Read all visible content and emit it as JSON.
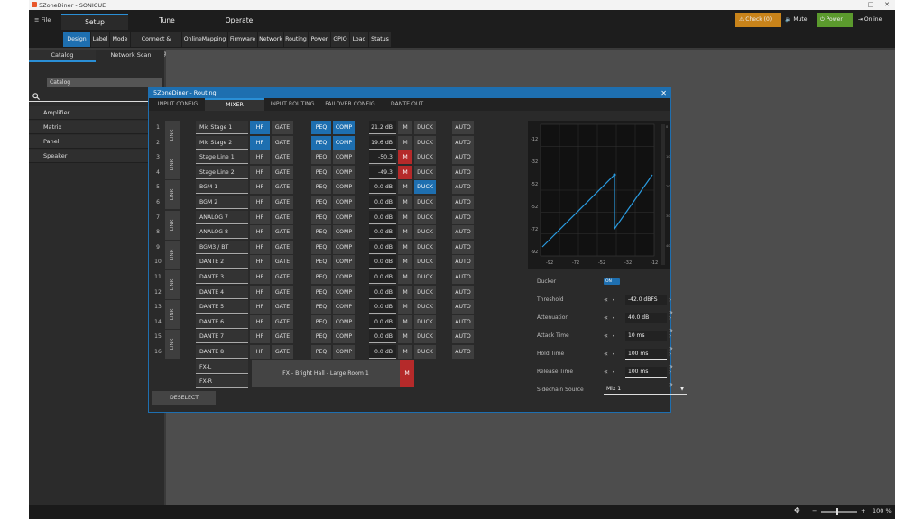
{
  "window": {
    "title": "5ZoneDiner - SONICUE",
    "minimize": "—",
    "maximize": "□",
    "close": "✕"
  },
  "topnav": {
    "file": "≡ File",
    "tabs": [
      "Setup",
      "Tune",
      "Operate"
    ],
    "check": "⚠ Check (0)",
    "mute": "🔈 Mute",
    "power": "⏻ Power",
    "online": "⇥ Online"
  },
  "subnav": [
    "Design",
    "Label",
    "Mode",
    "Connect & Setting",
    "OnlineMapping",
    "Firmware",
    "Network",
    "Routing",
    "Power",
    "GPIO",
    "Load",
    "Status"
  ],
  "left": {
    "tabs": [
      "Catalog",
      "Network Scan"
    ],
    "catalog_label": "Catalog",
    "tree": [
      "Amplifier",
      "Matrix",
      "Panel",
      "Speaker"
    ]
  },
  "status": {
    "zoom": "100 %",
    "minus": "−",
    "plus": "+"
  },
  "dialog": {
    "title": "5ZoneDiner - Routing",
    "close": "✕",
    "tabs": [
      "INPUT CONFIG",
      "MIXER",
      "INPUT ROUTING",
      "FAILOVER CONFIG",
      "DANTE OUT"
    ],
    "link_label": "LINK",
    "hp": "HP",
    "gate": "GATE",
    "peq": "PEQ",
    "comp": "COMP",
    "m": "M",
    "duck": "DUCK",
    "auto": "AUTO",
    "channels": [
      {
        "n": "1",
        "name": "Mic Stage 1",
        "level": "21.2 dB",
        "hp": true,
        "peq": true,
        "comp": true,
        "mute": false,
        "duck": false
      },
      {
        "n": "2",
        "name": "Mic Stage 2",
        "level": "19.6 dB",
        "hp": true,
        "peq": true,
        "comp": true,
        "mute": false,
        "duck": false
      },
      {
        "n": "3",
        "name": "Stage Line 1",
        "level": "-50.3 dB",
        "hp": false,
        "peq": false,
        "comp": false,
        "mute": true,
        "duck": false
      },
      {
        "n": "4",
        "name": "Stage Line 2",
        "level": "-49.3 dB",
        "hp": false,
        "peq": false,
        "comp": false,
        "mute": true,
        "duck": false
      },
      {
        "n": "5",
        "name": "BGM 1",
        "level": "0.0 dB",
        "hp": false,
        "peq": false,
        "comp": false,
        "mute": false,
        "duck": true
      },
      {
        "n": "6",
        "name": "BGM 2",
        "level": "0.0 dB",
        "hp": false,
        "peq": false,
        "comp": false,
        "mute": false,
        "duck": false
      },
      {
        "n": "7",
        "name": "ANALOG 7",
        "level": "0.0 dB",
        "hp": false,
        "peq": false,
        "comp": false,
        "mute": false,
        "duck": false
      },
      {
        "n": "8",
        "name": "ANALOG 8",
        "level": "0.0 dB",
        "hp": false,
        "peq": false,
        "comp": false,
        "mute": false,
        "duck": false
      },
      {
        "n": "9",
        "name": "BGM3 / BT",
        "level": "0.0 dB",
        "hp": false,
        "peq": false,
        "comp": false,
        "mute": false,
        "duck": false
      },
      {
        "n": "10",
        "name": "DANTE 2",
        "level": "0.0 dB",
        "hp": false,
        "peq": false,
        "comp": false,
        "mute": false,
        "duck": false
      },
      {
        "n": "11",
        "name": "DANTE 3",
        "level": "0.0 dB",
        "hp": false,
        "peq": false,
        "comp": false,
        "mute": false,
        "duck": false
      },
      {
        "n": "12",
        "name": "DANTE 4",
        "level": "0.0 dB",
        "hp": false,
        "peq": false,
        "comp": false,
        "mute": false,
        "duck": false
      },
      {
        "n": "13",
        "name": "DANTE 5",
        "level": "0.0 dB",
        "hp": false,
        "peq": false,
        "comp": false,
        "mute": false,
        "duck": false
      },
      {
        "n": "14",
        "name": "DANTE 6",
        "level": "0.0 dB",
        "hp": false,
        "peq": false,
        "comp": false,
        "mute": false,
        "duck": false
      },
      {
        "n": "15",
        "name": "DANTE 7",
        "level": "0.0 dB",
        "hp": false,
        "peq": false,
        "comp": false,
        "mute": false,
        "duck": false
      },
      {
        "n": "16",
        "name": "DANTE 8",
        "level": "0.0 dB",
        "hp": false,
        "peq": false,
        "comp": false,
        "mute": false,
        "duck": false
      }
    ],
    "fx": {
      "left": "FX-L",
      "right": "FX-R",
      "name": "FX - Bright Hall - Large Room 1",
      "mute": "M"
    },
    "deselect": "DESELECT",
    "graph": {
      "y_ticks": [
        "-12",
        "-32",
        "-52",
        "-52",
        "-72",
        "-92"
      ],
      "x_ticks": [
        "-92",
        "-72",
        "-52",
        "-32",
        "-12"
      ],
      "meter_ticks": [
        "0",
        "10",
        "20",
        "30",
        "40"
      ],
      "accent": "#2a9be0"
    },
    "ducker": {
      "label": "Ducker",
      "toggle": "ON",
      "params": [
        {
          "label": "Threshold",
          "value": "-42.0 dBFS"
        },
        {
          "label": "Attenuation",
          "value": "40.0 dB"
        },
        {
          "label": "Attack Time",
          "value": "10 ms"
        },
        {
          "label": "Hold Time",
          "value": "100 ms"
        },
        {
          "label": "Release Time",
          "value": "100 ms"
        }
      ],
      "sidechain_label": "Sidechain Source",
      "sidechain_value": "Mix 1"
    }
  }
}
